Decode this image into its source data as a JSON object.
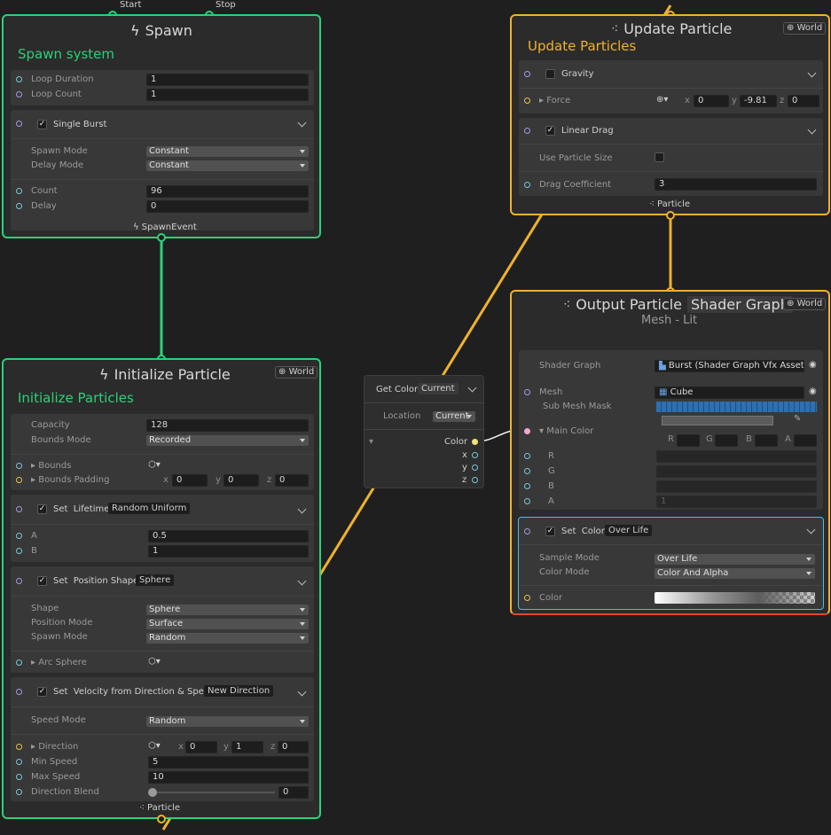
{
  "colors": {
    "spawn": "#2bd17a",
    "update": "#f0b22c",
    "output_bottom": "#e0492c",
    "set_color_sel": "#58b6e6",
    "bg": "#1f1f1f"
  },
  "top_labels": {
    "start": "Start",
    "stop": "Stop"
  },
  "spawn": {
    "title": "Spawn",
    "subtitle": "Spawn system",
    "icon": "bolt-icon",
    "loop_duration_label": "Loop Duration",
    "loop_duration": "1",
    "loop_count_label": "Loop Count",
    "loop_count": "1",
    "burst_label": "Single Burst",
    "spawn_mode_label": "Spawn Mode",
    "spawn_mode": "Constant",
    "delay_mode_label": "Delay Mode",
    "delay_mode": "Constant",
    "count_label": "Count",
    "count": "96",
    "delay_label": "Delay",
    "delay": "0",
    "footer": "SpawnEvent"
  },
  "init": {
    "title": "Initialize Particle",
    "subtitle": "Initialize Particles",
    "space": "World",
    "capacity_label": "Capacity",
    "capacity": "128",
    "bounds_mode_label": "Bounds Mode",
    "bounds_mode": "Recorded",
    "bounds_label": "Bounds",
    "bounds_padding_label": "Bounds Padding",
    "bp_x": "0",
    "bp_y": "0",
    "bp_z": "0",
    "lifetime": {
      "set": "Set",
      "attr": "Lifetime",
      "tag": "Random Uniform",
      "a_label": "A",
      "a": "0.5",
      "b_label": "B",
      "b": "1"
    },
    "position": {
      "set": "Set",
      "attr": "Position Shape",
      "tag": "Sphere",
      "shape_label": "Shape",
      "shape": "Sphere",
      "pos_mode_label": "Position Mode",
      "pos_mode": "Surface",
      "spawn_mode_label": "Spawn Mode",
      "spawn_mode": "Random",
      "arc_label": "Arc Sphere"
    },
    "velocity": {
      "set": "Set",
      "attr": "Velocity from Direction & Speed",
      "tag": "New Direction",
      "speed_mode_label": "Speed Mode",
      "speed_mode": "Random",
      "direction_label": "Direction",
      "dx": "0",
      "dy": "1",
      "dz": "0",
      "min_speed_label": "Min Speed",
      "min_speed": "5",
      "max_speed_label": "Max Speed",
      "max_speed": "10",
      "blend_label": "Direction Blend",
      "blend": "0"
    },
    "footer": "Particle"
  },
  "update": {
    "title": "Update Particle",
    "subtitle": "Update Particles",
    "space": "World",
    "gravity_label": "Gravity",
    "force_label": "Force",
    "fx": "0",
    "fy": "-9.81",
    "fz": "0",
    "drag_label": "Linear Drag",
    "use_size_label": "Use Particle Size",
    "drag_coef_label": "Drag Coefficient",
    "drag_coef": "3",
    "footer": "Particle"
  },
  "output": {
    "title": "Output Particle",
    "title_tag": "Shader Graph",
    "subtitle": "Mesh - Lit",
    "space": "World",
    "shader_graph_label": "Shader Graph",
    "shader_graph": "Burst (Shader Graph Vfx Asset)",
    "mesh_label": "Mesh",
    "mesh": "Cube",
    "sub_mesh_label": "Sub Mesh Mask",
    "main_color_label": "Main Color",
    "r_label": "R",
    "g_label": "G",
    "b_label": "B",
    "a_label": "A",
    "a_value": "1",
    "set_color": {
      "set": "Set",
      "attr": "Color",
      "tag": "Over Life",
      "sample_mode_label": "Sample Mode",
      "sample_mode": "Over Life",
      "color_mode_label": "Color Mode",
      "color_mode": "Color And Alpha",
      "color_label": "Color"
    }
  },
  "get_color": {
    "title": "Get Color",
    "tag": "Current",
    "location_label": "Location",
    "location": "Current",
    "color_label": "Color",
    "x": "x",
    "y": "y",
    "z": "z"
  },
  "xyz": {
    "x": "x",
    "y": "y",
    "z": "z"
  }
}
